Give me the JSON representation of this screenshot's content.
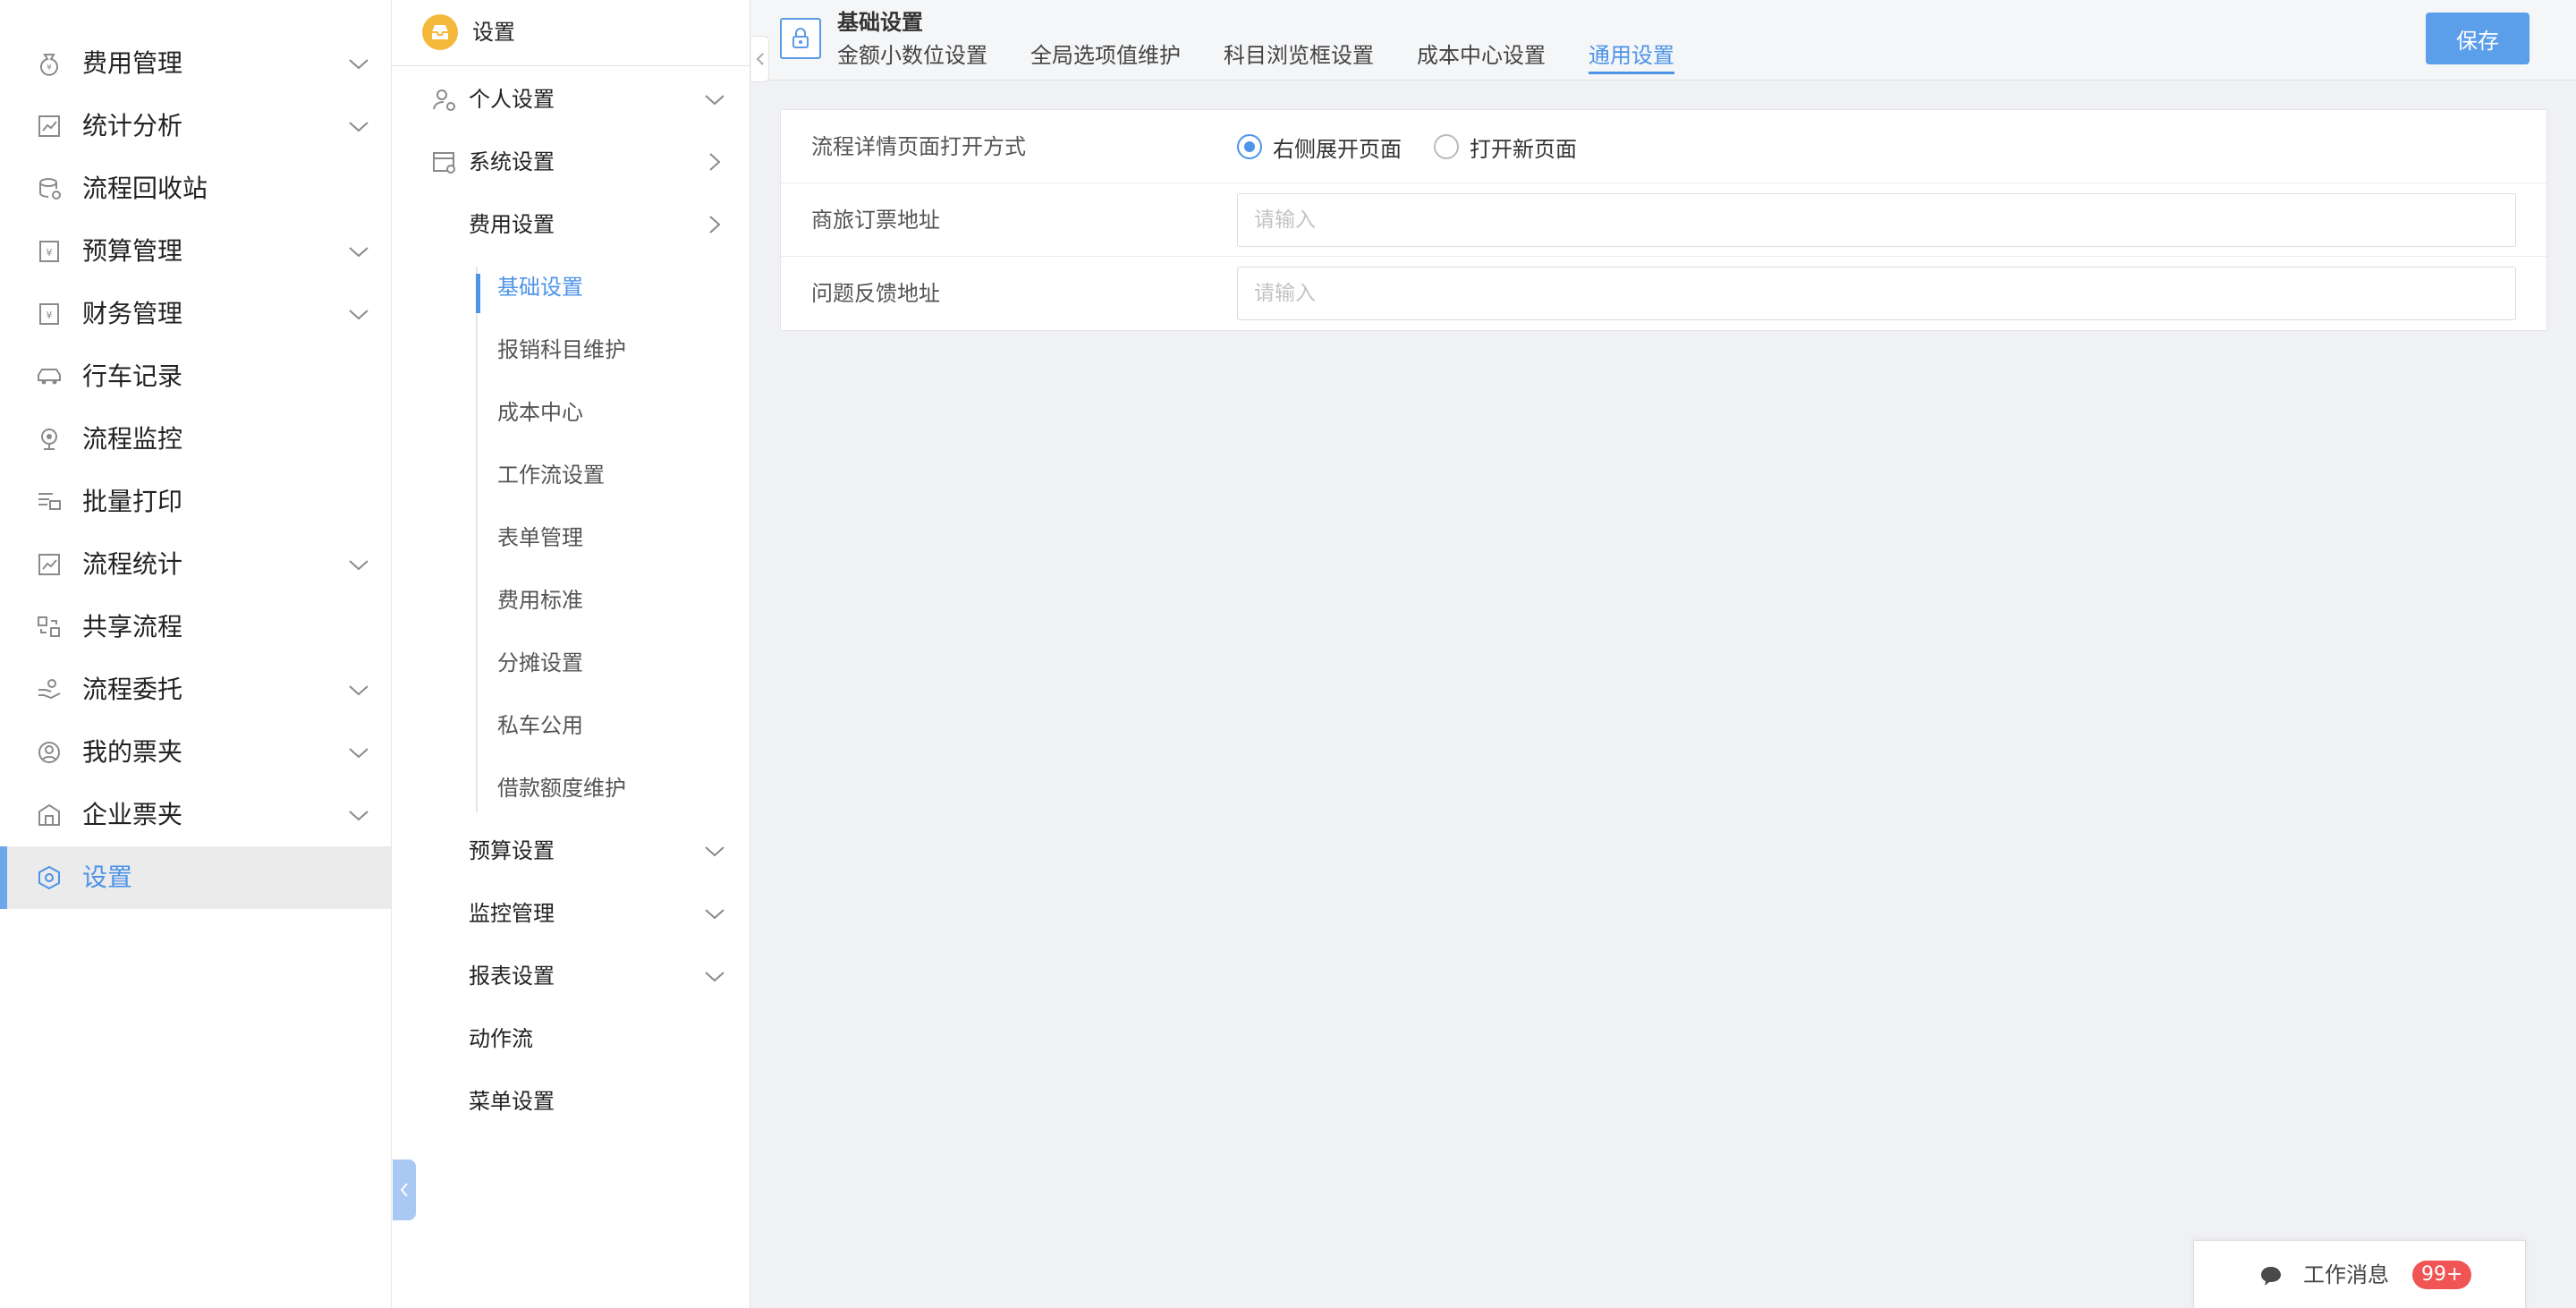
{
  "main_nav": [
    {
      "label": "费用管理",
      "icon": "money-bag-icon",
      "expandable": true
    },
    {
      "label": "统计分析",
      "icon": "stats-chart-icon",
      "expandable": true
    },
    {
      "label": "流程回收站",
      "icon": "recycle-stack-icon",
      "expandable": false
    },
    {
      "label": "预算管理",
      "icon": "budget-yen-icon",
      "expandable": true
    },
    {
      "label": "财务管理",
      "icon": "finance-yen-icon",
      "expandable": true
    },
    {
      "label": "行车记录",
      "icon": "car-icon",
      "expandable": false
    },
    {
      "label": "流程监控",
      "icon": "camera-monitor-icon",
      "expandable": false
    },
    {
      "label": "批量打印",
      "icon": "printer-icon",
      "expandable": false
    },
    {
      "label": "流程统计",
      "icon": "flow-stats-icon",
      "expandable": true
    },
    {
      "label": "共享流程",
      "icon": "share-flow-icon",
      "expandable": false
    },
    {
      "label": "流程委托",
      "icon": "delegate-hand-icon",
      "expandable": true
    },
    {
      "label": "我的票夹",
      "icon": "user-circle-icon",
      "expandable": true
    },
    {
      "label": "企业票夹",
      "icon": "building-icon",
      "expandable": true
    },
    {
      "label": "设置",
      "icon": "settings-hex-icon",
      "expandable": false,
      "active": true
    }
  ],
  "sub_nav": {
    "header": "设置",
    "groups": {
      "personal": "个人设置",
      "system": "系统设置",
      "expense": "费用设置"
    },
    "expense_leaves": [
      "基础设置",
      "报销科目维护",
      "成本中心",
      "工作流设置",
      "表单管理",
      "费用标准",
      "分摊设置",
      "私车公用",
      "借款额度维护"
    ],
    "other_items": [
      {
        "label": "预算设置",
        "expandable": true
      },
      {
        "label": "监控管理",
        "expandable": true
      },
      {
        "label": "报表设置",
        "expandable": true
      },
      {
        "label": "动作流",
        "expandable": false
      },
      {
        "label": "菜单设置",
        "expandable": false
      }
    ]
  },
  "topbar": {
    "title": "基础设置",
    "tabs": [
      "金额小数位设置",
      "全局选项值维护",
      "科目浏览框设置",
      "成本中心设置",
      "通用设置"
    ],
    "active_tab": 4,
    "save_label": "保存"
  },
  "form": {
    "open_mode": {
      "label": "流程详情页面打开方式",
      "options": [
        "右侧展开页面",
        "打开新页面"
      ],
      "selected": 0
    },
    "travel_url": {
      "label": "商旅订票地址",
      "value": "",
      "placeholder": "请输入"
    },
    "feedback_url": {
      "label": "问题反馈地址",
      "value": "",
      "placeholder": "请输入"
    }
  },
  "messages": {
    "label": "工作消息",
    "count": "99+"
  },
  "colors": {
    "accent": "#4d93e8",
    "save_button": "#5b9ee9",
    "badge": "#f4b93b",
    "unread": "#f05454",
    "background": "#f0f1f5"
  }
}
